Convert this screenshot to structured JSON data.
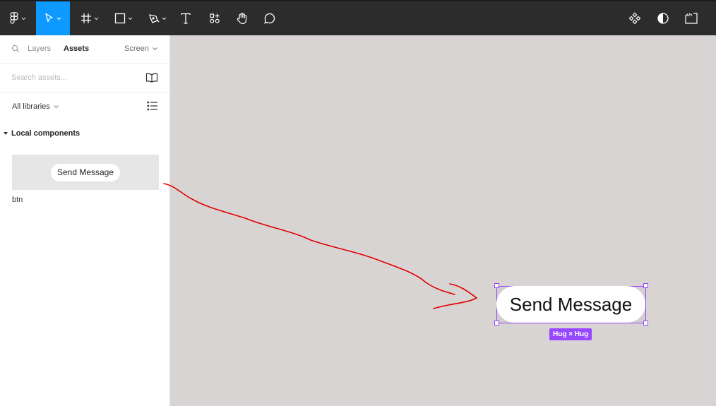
{
  "colors": {
    "toolbar_bg": "#2c2c2c",
    "active_tool": "#0d99ff",
    "canvas_bg": "#d9d4d4",
    "selection": "#9747ff",
    "annotation": "#e00000"
  },
  "toolbar": {
    "left_tools": [
      {
        "icon": "figma-logo-icon",
        "has_menu": true,
        "active": false
      },
      {
        "icon": "move-cursor-icon",
        "has_menu": true,
        "active": true
      },
      {
        "icon": "frame-icon",
        "has_menu": true,
        "active": false
      },
      {
        "icon": "rectangle-icon",
        "has_menu": true,
        "active": false
      },
      {
        "icon": "pen-icon",
        "has_menu": true,
        "active": false
      },
      {
        "icon": "text-icon",
        "has_menu": false,
        "active": false
      },
      {
        "icon": "resources-icon",
        "has_menu": false,
        "active": false
      },
      {
        "icon": "hand-icon",
        "has_menu": false,
        "active": false
      },
      {
        "icon": "comment-icon",
        "has_menu": false,
        "active": false
      }
    ],
    "right_tools": [
      {
        "icon": "component-icon"
      },
      {
        "icon": "contrast-icon"
      },
      {
        "icon": "dev-mode-icon"
      }
    ]
  },
  "panel": {
    "tabs": {
      "layers": "Layers",
      "assets": "Assets",
      "page": "Screen"
    },
    "search": {
      "placeholder": "Search assets...",
      "value": ""
    },
    "libraries_label": "All libraries",
    "section_title": "Local components",
    "component": {
      "preview_label": "Send Message",
      "name": "btn"
    }
  },
  "canvas": {
    "button_label": "Send Message",
    "size_badge": "Hug × Hug"
  }
}
